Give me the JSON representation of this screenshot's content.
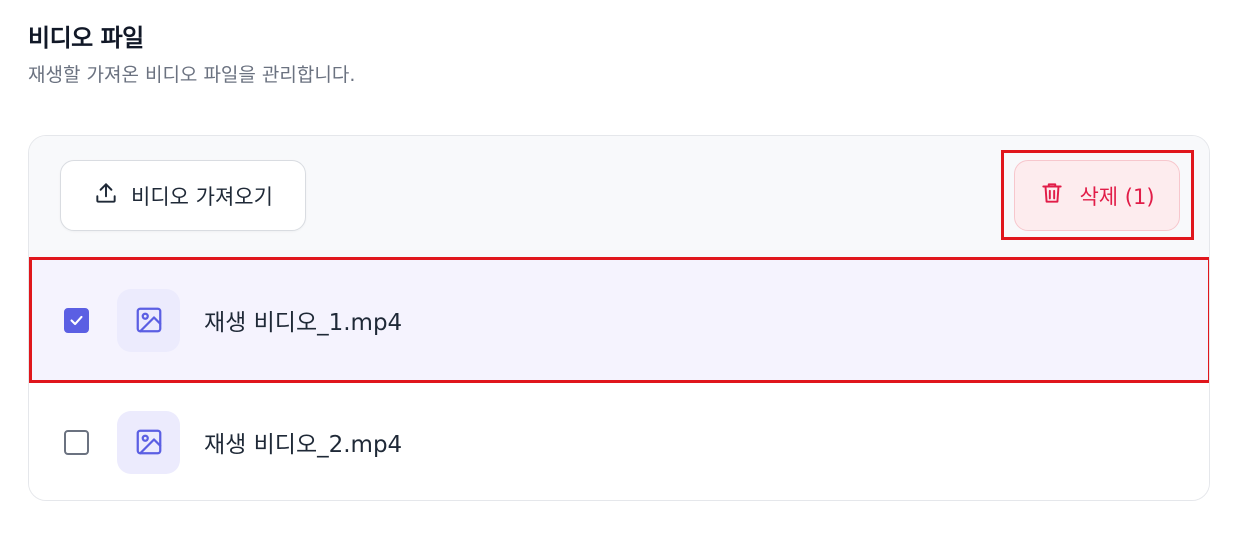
{
  "section": {
    "title": "비디오 파일",
    "description": "재생할 가져온 비디오 파일을 관리합니다."
  },
  "toolbar": {
    "import_label": "비디오 가져오기",
    "delete_label": "삭제 (1)"
  },
  "files": [
    {
      "name": "재생 비디오_1.mp4",
      "checked": true
    },
    {
      "name": "재생 비디오_2.mp4",
      "checked": false
    }
  ],
  "colors": {
    "accent": "#5b5fe3",
    "danger": "#e11d48",
    "highlight": "#e0161c"
  }
}
